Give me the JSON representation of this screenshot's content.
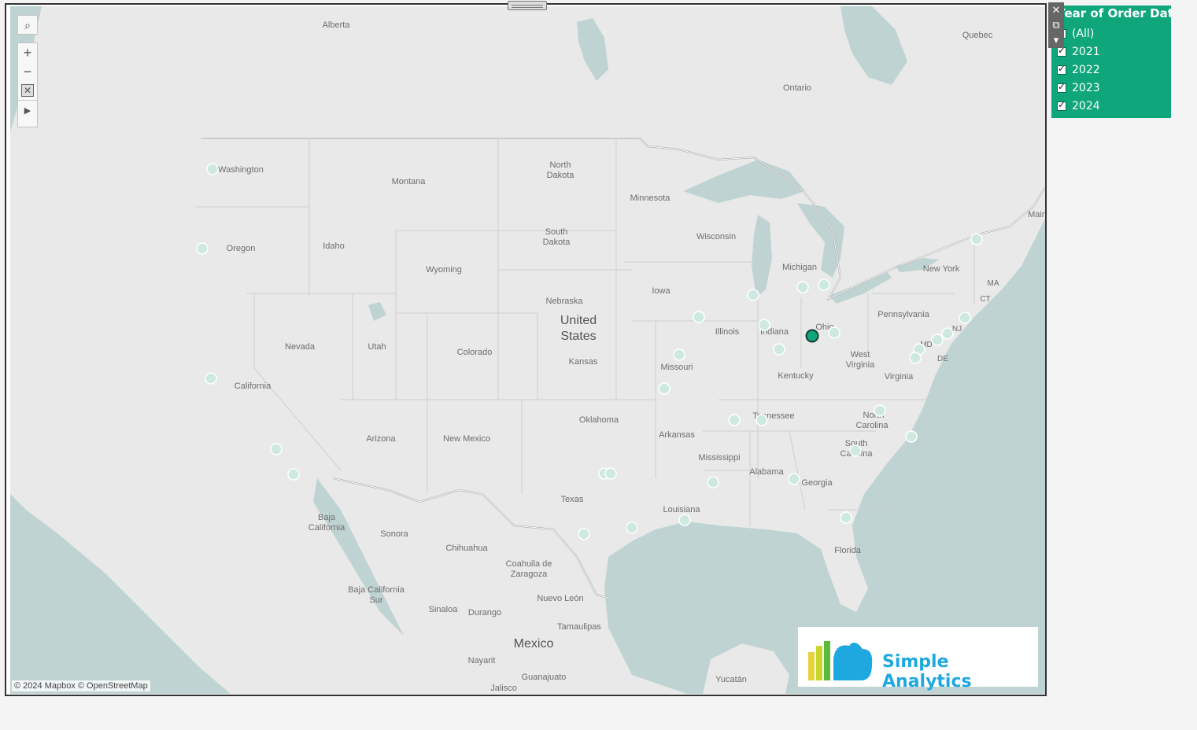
{
  "map": {
    "labels": {
      "alberta": "Alberta",
      "quebec": "Quebec",
      "ontario": "Ontario",
      "washington": "Washington",
      "montana": "Montana",
      "north_dakota_1": "North",
      "north_dakota_2": "Dakota",
      "minnesota": "Minnesota",
      "wisconsin": "Wisconsin",
      "michigan": "Michigan",
      "oregon": "Oregon",
      "idaho": "Idaho",
      "south_dakota_1": "South",
      "south_dakota_2": "Dakota",
      "wyoming": "Wyoming",
      "new_york": "New York",
      "ma": "MA",
      "ct": "CT",
      "nebraska": "Nebraska",
      "iowa": "Iowa",
      "illinois": "Illinois",
      "indiana": "Indiana",
      "ohio": "Ohio",
      "pennsylvania": "Pennsylvania",
      "nj": "NJ",
      "md": "MD",
      "de": "DE",
      "united_1": "United",
      "united_2": "States",
      "nevada": "Nevada",
      "utah": "Utah",
      "colorado": "Colorado",
      "kansas": "Kansas",
      "missouri": "Missouri",
      "west_virginia_1": "West",
      "west_virginia_2": "Virginia",
      "virginia": "Virginia",
      "kentucky": "Kentucky",
      "california": "California",
      "tennessee": "Tennessee",
      "north_carolina_1": "North",
      "north_carolina_2": "Carolina",
      "oklahoma": "Oklahoma",
      "arkansas": "Arkansas",
      "arizona": "Arizona",
      "new_mexico": "New Mexico",
      "south_carolina_1": "South",
      "south_carolina_2": "Carolina",
      "mississippi": "Mississippi",
      "alabama": "Alabama",
      "georgia": "Georgia",
      "texas": "Texas",
      "louisiana": "Louisiana",
      "baja_california_1": "Baja",
      "baja_california_2": "California",
      "sonora": "Sonora",
      "chihuahua": "Chihuahua",
      "coahuila_1": "Coahuila de",
      "coahuila_2": "Zaragoza",
      "florida": "Florida",
      "baja_sur_1": "Baja California",
      "baja_sur_2": "Sur",
      "sinaloa": "Sinaloa",
      "durango": "Durango",
      "nuevo_leon": "Nuevo León",
      "tamaulipas": "Tamaulipas",
      "mexico": "Mexico",
      "nayarit": "Nayarit",
      "guanajuato": "Guanajuato",
      "jalisco": "Jalisco",
      "yucatan": "Yucatán",
      "maine": "Main"
    },
    "attribution": "© 2024 Mapbox © OpenStreetMap",
    "point_color": "#cde9e2",
    "selected_color": "#10a67b"
  },
  "logo": {
    "text": "Simple Analytics"
  },
  "filter": {
    "title": "Year of Order Date",
    "options": [
      "(All)",
      "2021",
      "2022",
      "2023",
      "2024"
    ]
  },
  "colors": {
    "filter_bg": "#10a67b",
    "logo_blue": "#1fa8e0"
  }
}
